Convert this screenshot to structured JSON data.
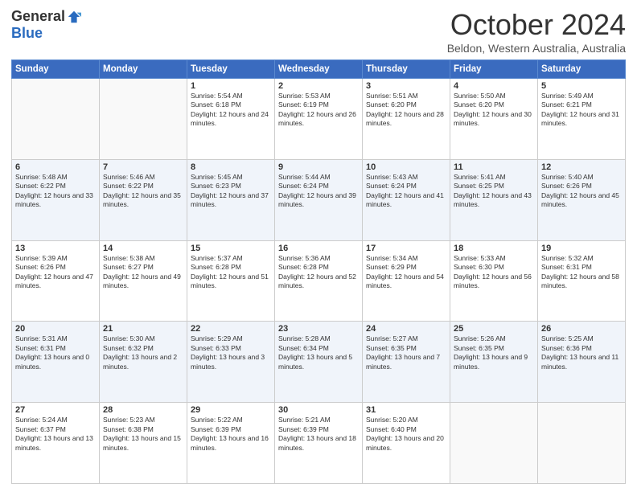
{
  "logo": {
    "general": "General",
    "blue": "Blue"
  },
  "header": {
    "month": "October 2024",
    "location": "Beldon, Western Australia, Australia"
  },
  "days_of_week": [
    "Sunday",
    "Monday",
    "Tuesday",
    "Wednesday",
    "Thursday",
    "Friday",
    "Saturday"
  ],
  "weeks": [
    [
      {
        "day": "",
        "info": ""
      },
      {
        "day": "",
        "info": ""
      },
      {
        "day": "1",
        "info": "Sunrise: 5:54 AM\nSunset: 6:18 PM\nDaylight: 12 hours and 24 minutes."
      },
      {
        "day": "2",
        "info": "Sunrise: 5:53 AM\nSunset: 6:19 PM\nDaylight: 12 hours and 26 minutes."
      },
      {
        "day": "3",
        "info": "Sunrise: 5:51 AM\nSunset: 6:20 PM\nDaylight: 12 hours and 28 minutes."
      },
      {
        "day": "4",
        "info": "Sunrise: 5:50 AM\nSunset: 6:20 PM\nDaylight: 12 hours and 30 minutes."
      },
      {
        "day": "5",
        "info": "Sunrise: 5:49 AM\nSunset: 6:21 PM\nDaylight: 12 hours and 31 minutes."
      }
    ],
    [
      {
        "day": "6",
        "info": "Sunrise: 5:48 AM\nSunset: 6:22 PM\nDaylight: 12 hours and 33 minutes."
      },
      {
        "day": "7",
        "info": "Sunrise: 5:46 AM\nSunset: 6:22 PM\nDaylight: 12 hours and 35 minutes."
      },
      {
        "day": "8",
        "info": "Sunrise: 5:45 AM\nSunset: 6:23 PM\nDaylight: 12 hours and 37 minutes."
      },
      {
        "day": "9",
        "info": "Sunrise: 5:44 AM\nSunset: 6:24 PM\nDaylight: 12 hours and 39 minutes."
      },
      {
        "day": "10",
        "info": "Sunrise: 5:43 AM\nSunset: 6:24 PM\nDaylight: 12 hours and 41 minutes."
      },
      {
        "day": "11",
        "info": "Sunrise: 5:41 AM\nSunset: 6:25 PM\nDaylight: 12 hours and 43 minutes."
      },
      {
        "day": "12",
        "info": "Sunrise: 5:40 AM\nSunset: 6:26 PM\nDaylight: 12 hours and 45 minutes."
      }
    ],
    [
      {
        "day": "13",
        "info": "Sunrise: 5:39 AM\nSunset: 6:26 PM\nDaylight: 12 hours and 47 minutes."
      },
      {
        "day": "14",
        "info": "Sunrise: 5:38 AM\nSunset: 6:27 PM\nDaylight: 12 hours and 49 minutes."
      },
      {
        "day": "15",
        "info": "Sunrise: 5:37 AM\nSunset: 6:28 PM\nDaylight: 12 hours and 51 minutes."
      },
      {
        "day": "16",
        "info": "Sunrise: 5:36 AM\nSunset: 6:28 PM\nDaylight: 12 hours and 52 minutes."
      },
      {
        "day": "17",
        "info": "Sunrise: 5:34 AM\nSunset: 6:29 PM\nDaylight: 12 hours and 54 minutes."
      },
      {
        "day": "18",
        "info": "Sunrise: 5:33 AM\nSunset: 6:30 PM\nDaylight: 12 hours and 56 minutes."
      },
      {
        "day": "19",
        "info": "Sunrise: 5:32 AM\nSunset: 6:31 PM\nDaylight: 12 hours and 58 minutes."
      }
    ],
    [
      {
        "day": "20",
        "info": "Sunrise: 5:31 AM\nSunset: 6:31 PM\nDaylight: 13 hours and 0 minutes."
      },
      {
        "day": "21",
        "info": "Sunrise: 5:30 AM\nSunset: 6:32 PM\nDaylight: 13 hours and 2 minutes."
      },
      {
        "day": "22",
        "info": "Sunrise: 5:29 AM\nSunset: 6:33 PM\nDaylight: 13 hours and 3 minutes."
      },
      {
        "day": "23",
        "info": "Sunrise: 5:28 AM\nSunset: 6:34 PM\nDaylight: 13 hours and 5 minutes."
      },
      {
        "day": "24",
        "info": "Sunrise: 5:27 AM\nSunset: 6:35 PM\nDaylight: 13 hours and 7 minutes."
      },
      {
        "day": "25",
        "info": "Sunrise: 5:26 AM\nSunset: 6:35 PM\nDaylight: 13 hours and 9 minutes."
      },
      {
        "day": "26",
        "info": "Sunrise: 5:25 AM\nSunset: 6:36 PM\nDaylight: 13 hours and 11 minutes."
      }
    ],
    [
      {
        "day": "27",
        "info": "Sunrise: 5:24 AM\nSunset: 6:37 PM\nDaylight: 13 hours and 13 minutes."
      },
      {
        "day": "28",
        "info": "Sunrise: 5:23 AM\nSunset: 6:38 PM\nDaylight: 13 hours and 15 minutes."
      },
      {
        "day": "29",
        "info": "Sunrise: 5:22 AM\nSunset: 6:39 PM\nDaylight: 13 hours and 16 minutes."
      },
      {
        "day": "30",
        "info": "Sunrise: 5:21 AM\nSunset: 6:39 PM\nDaylight: 13 hours and 18 minutes."
      },
      {
        "day": "31",
        "info": "Sunrise: 5:20 AM\nSunset: 6:40 PM\nDaylight: 13 hours and 20 minutes."
      },
      {
        "day": "",
        "info": ""
      },
      {
        "day": "",
        "info": ""
      }
    ]
  ]
}
